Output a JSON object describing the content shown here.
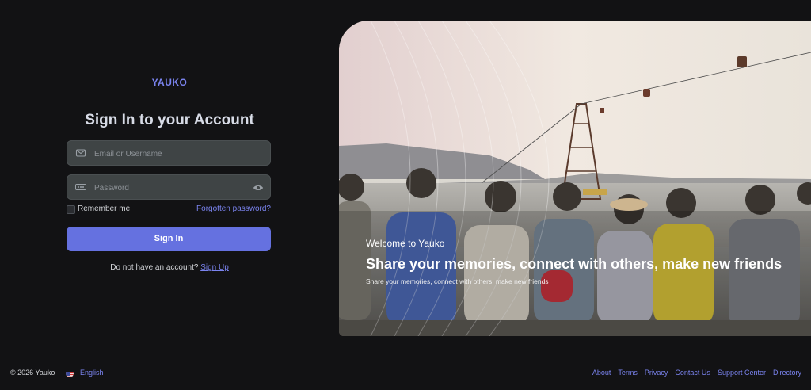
{
  "brand": {
    "logo": "YAUKO"
  },
  "login": {
    "title": "Sign In to your Account",
    "email_placeholder": "Email or Username",
    "password_placeholder": "Password",
    "remember_label": "Remember me",
    "forgot_label": "Forgotten password?",
    "signin_label": "Sign In",
    "signup_prompt": "Do not have an account?",
    "signup_label": "Sign Up"
  },
  "hero": {
    "eyebrow": "Welcome to Yauko",
    "headline": "Share your memories, connect with others, make new friends",
    "subtext": "Share your memories, connect with others, make new friends"
  },
  "footer": {
    "copyright": "© 2026 Yauko",
    "language": "English",
    "links": [
      "About",
      "Terms",
      "Privacy",
      "Contact Us",
      "Support Center",
      "Directory"
    ]
  },
  "colors": {
    "accent": "#6571e0",
    "link": "#7b84f0",
    "background": "#121214",
    "input_bg": "#3f4445"
  },
  "icons": {
    "email": "email-icon",
    "password": "password-dots-icon",
    "toggle_visibility": "eye-icon",
    "language_flag": "us-flag-icon"
  }
}
